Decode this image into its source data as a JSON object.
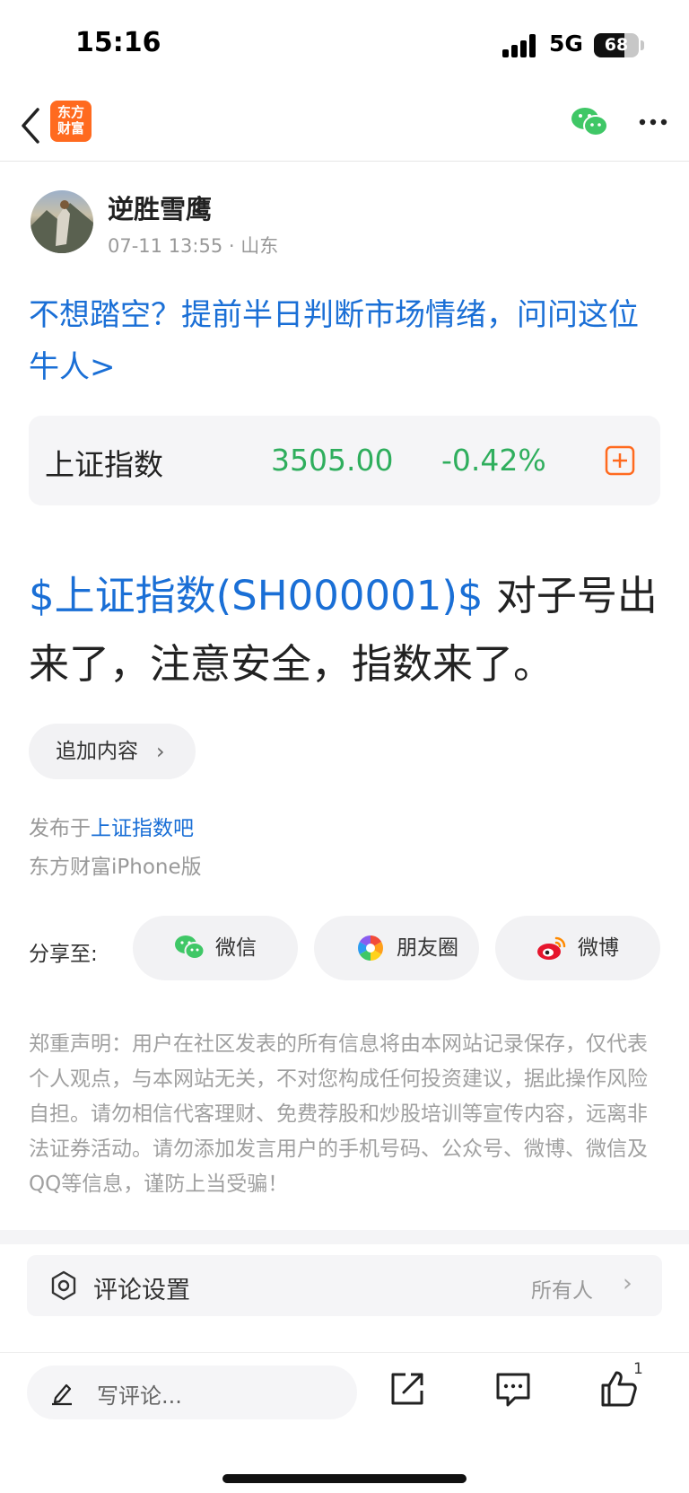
{
  "status": {
    "time": "15:16",
    "network": "5G",
    "battery": "68",
    "battery_level": 0.68
  },
  "nav": {
    "logo_line1": "东方",
    "logo_line2": "财富"
  },
  "author": {
    "name": "逆胜雪鹰",
    "meta": "07-11 13:55 · 山东"
  },
  "promo": {
    "text": "不想踏空？提前半日判断市场情绪，问问这位牛人>"
  },
  "stock_card": {
    "name": "上证指数",
    "price": "3505.00",
    "change": "-0.42%",
    "change_color": "#2fae5d"
  },
  "post": {
    "stock_link": "$上证指数(SH000001)$",
    "text": " 对子号出来了，注意安全，指数来了。"
  },
  "append_button": {
    "label": "追加内容"
  },
  "published": {
    "prefix": "发布于",
    "forum": "上证指数吧",
    "client": "东方财富iPhone版"
  },
  "share": {
    "label": "分享至:",
    "options": [
      {
        "label": "微信",
        "icon": "wechat-icon"
      },
      {
        "label": "朋友圈",
        "icon": "moments-icon"
      },
      {
        "label": "微博",
        "icon": "weibo-icon"
      }
    ]
  },
  "disclaimer": "郑重声明：用户在社区发表的所有信息将由本网站记录保存，仅代表个人观点，与本网站无关，不对您构成任何投资建议，据此操作风险自担。请勿相信代客理财、免费荐股和炒股培训等宣传内容，远离非法证券活动。请勿添加发言用户的手机号码、公众号、微博、微信及QQ等信息，谨防上当受骗！",
  "comment_settings": {
    "label": "评论设置",
    "value": "所有人"
  },
  "bottom_bar": {
    "comment_placeholder": "写评论...",
    "like_count": "1"
  },
  "colors": {
    "link_blue": "#1a6fd6",
    "brand_orange": "#ff6a1f",
    "down_green": "#2fae5d"
  }
}
